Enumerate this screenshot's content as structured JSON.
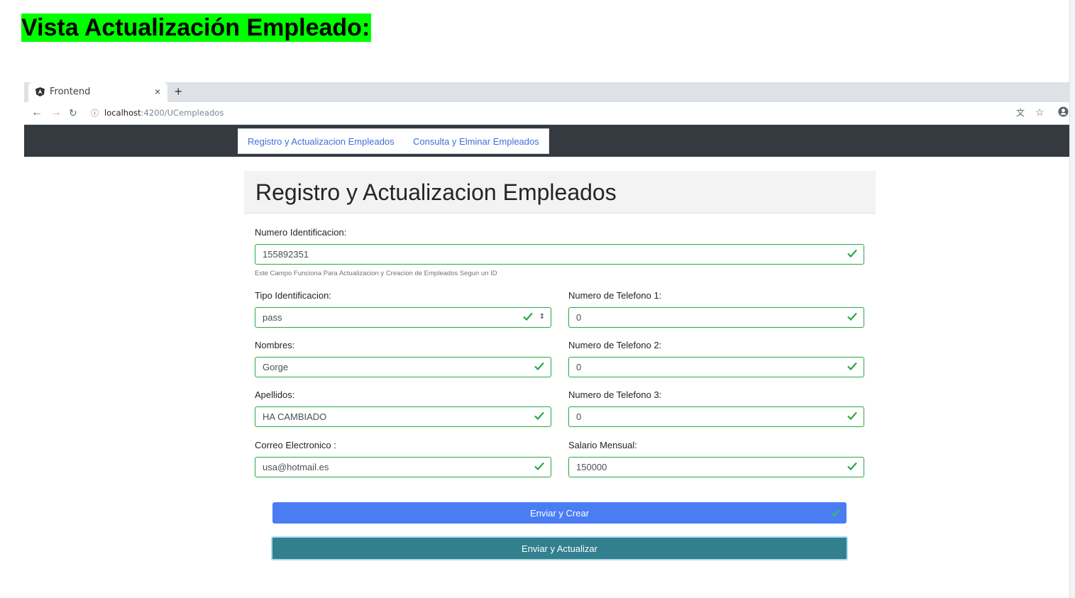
{
  "doc_title": "Vista Actualización Empleado:",
  "browser": {
    "tab_title": "Frontend",
    "tab_close": "×",
    "new_tab": "+",
    "url_host": "localhost",
    "url_path": ":4200/UCempleados",
    "icons": [
      "angular-favicon-icon",
      "back-arrow-icon",
      "forward-arrow-icon",
      "reload-icon",
      "info-icon",
      "translate-icon",
      "star-icon",
      "profile-icon"
    ]
  },
  "nav": {
    "link_registro": "Registro y Actualizacion Empleados",
    "link_consulta": "Consulta y Elminar Empleados"
  },
  "page": {
    "heading": "Registro y Actualizacion Empleados"
  },
  "form": {
    "numero_identificacion": {
      "label": "Numero Identificacion:",
      "value": "155892351",
      "help": "Este Campo Funciona Para Actualizacion y Creacion de Empleados Segun un ID"
    },
    "tipo_identificacion": {
      "label": "Tipo Identificacion:",
      "value": "pass"
    },
    "nombres": {
      "label": "Nombres:",
      "value": "Gorge"
    },
    "apellidos": {
      "label": "Apellidos:",
      "value": "HA CAMBIADO"
    },
    "correo": {
      "label": "Correo Electronico :",
      "value": "usa@hotmail.es"
    },
    "telefono1": {
      "label": "Numero de Telefono 1:",
      "value": "0"
    },
    "telefono2": {
      "label": "Numero de Telefono 2:",
      "value": "0"
    },
    "telefono3": {
      "label": "Numero de Telefono 3:",
      "value": "0"
    },
    "salario": {
      "label": "Salario Mensual:",
      "value": "150000"
    }
  },
  "buttons": {
    "crear": "Enviar y Crear",
    "actualizar": "Enviar y Actualizar"
  },
  "colors": {
    "highlight": "#00ff00",
    "valid": "#28a745",
    "navbar": "#343a40",
    "primary": "#4a7cf4",
    "info": "#327f8e"
  }
}
